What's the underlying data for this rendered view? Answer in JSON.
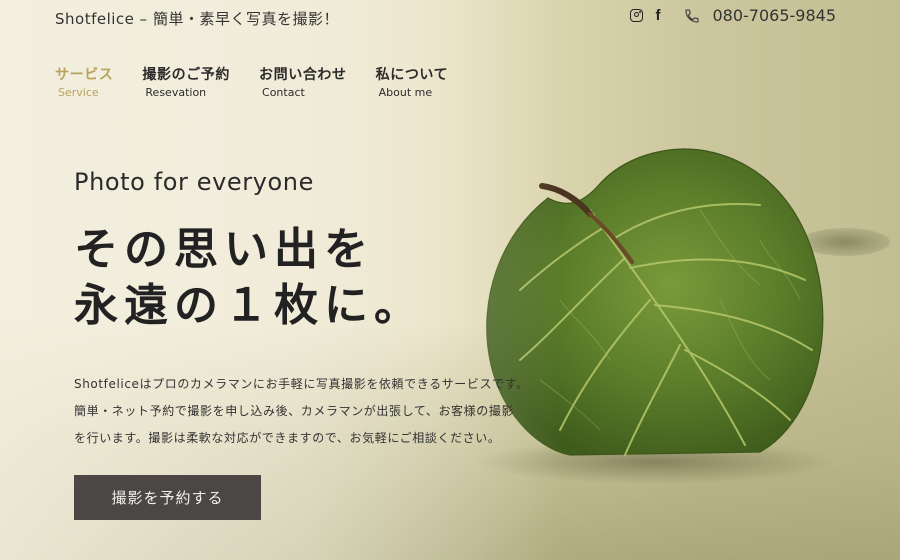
{
  "header": {
    "site_title": "Shotfelice – 簡単・素早く写真を撮影！",
    "phone": "080-7065-9845",
    "icons": [
      "instagram-icon",
      "facebook-icon",
      "phone-icon"
    ],
    "facebook_glyph": "f"
  },
  "nav": {
    "items": [
      {
        "jp": "サービス",
        "en": "Service",
        "active": true
      },
      {
        "jp": "撮影のご予約",
        "en": "Resevation",
        "active": false
      },
      {
        "jp": "お問い合わせ",
        "en": "Contact",
        "active": false
      },
      {
        "jp": "私について",
        "en": "About me",
        "active": false
      }
    ],
    "active_color": "#b8a35e"
  },
  "hero": {
    "subtitle": "Photo for everyone",
    "headline_line1": "その思い出を",
    "headline_line2": "永遠の１枚に。",
    "description_line1": "Shotfeliceはプロのカメラマンにお手軽に写真撮影を依頼できるサービスです。",
    "description_line2": "簡単・ネット予約で撮影を申し込み後、カメラマンが出張して、お客様の撮影",
    "description_line3": "を行います。撮影は柔軟な対応ができますので、お気軽にご相談ください。",
    "cta_label": "撮影を予約する"
  },
  "colors": {
    "button_bg": "#4a4744",
    "leaf_green": "#5f7f2e"
  }
}
